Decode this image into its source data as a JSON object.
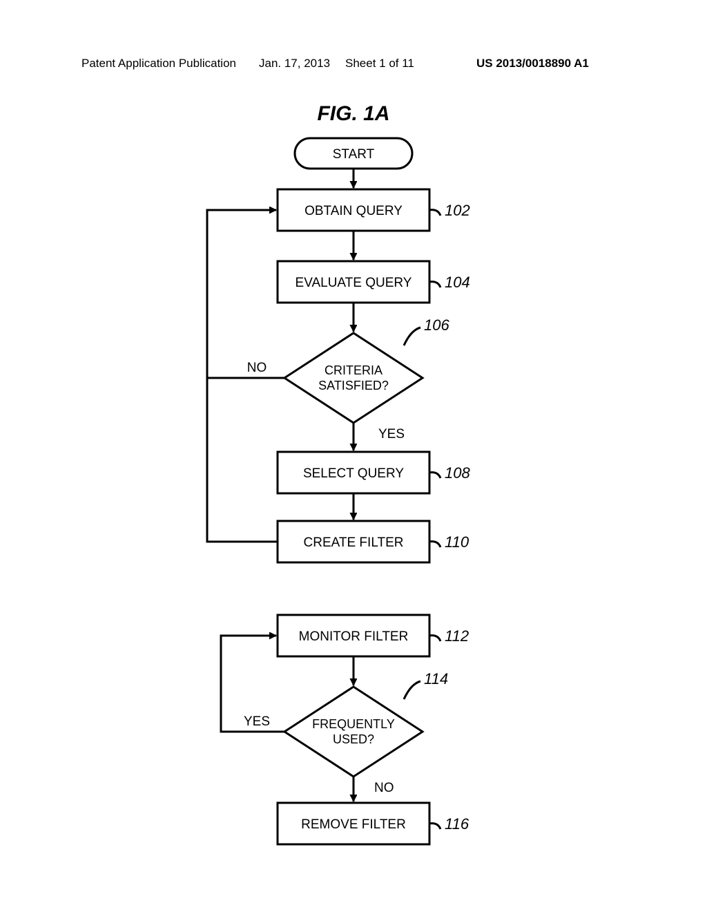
{
  "header": {
    "left": "Patent Application Publication",
    "date": "Jan. 17, 2013",
    "sheet": "Sheet 1 of 11",
    "pubno": "US 2013/0018890 A1"
  },
  "figure": {
    "title": "FIG. 1A",
    "start": "START",
    "step102": {
      "label": "OBTAIN QUERY",
      "ref": "102"
    },
    "step104": {
      "label": "EVALUATE QUERY",
      "ref": "104"
    },
    "dec106": {
      "label_l1": "CRITERIA",
      "label_l2": "SATISFIED?",
      "ref": "106",
      "no": "NO",
      "yes": "YES"
    },
    "step108": {
      "label": "SELECT QUERY",
      "ref": "108"
    },
    "step110": {
      "label": "CREATE FILTER",
      "ref": "110"
    },
    "step112": {
      "label": "MONITOR FILTER",
      "ref": "112"
    },
    "dec114": {
      "label_l1": "FREQUENTLY",
      "label_l2": "USED?",
      "ref": "114",
      "no": "NO",
      "yes": "YES"
    },
    "step116": {
      "label": "REMOVE FILTER",
      "ref": "116"
    }
  }
}
